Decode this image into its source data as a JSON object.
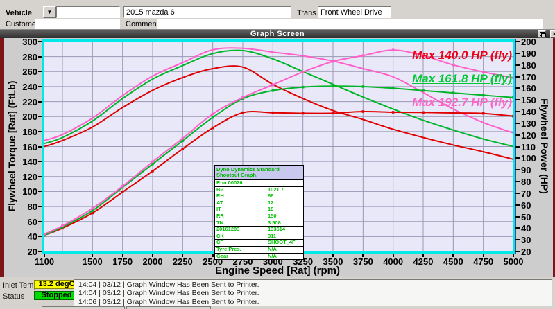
{
  "top_panel": {
    "vehicle_label": "Vehicle",
    "vehicle_select_value": "",
    "vehicle_name_value": "2015 mazda 6",
    "trans_label": "Trans.",
    "trans_value": "Front Wheel Drive",
    "customer_label": "Customer",
    "customer_value": "",
    "comment_label": "Comment",
    "comment_value": ""
  },
  "window": {
    "title": "Graph Screen"
  },
  "icons": {
    "dropdown_arrow": "▼",
    "close": "×"
  },
  "chart_data": {
    "type": "line",
    "xlabel": "Engine Speed [Rat] (rpm)",
    "ylabel_left": "Flywheel Torque [Rat] (FtLb)",
    "ylabel_right": "Flywheel Power (HP)",
    "xlim": [
      1100,
      5000
    ],
    "ylim_left": [
      20,
      300
    ],
    "ylim_right": [
      20,
      200
    ],
    "x_tick_labels": [
      1100,
      1500,
      1750,
      2000,
      2250,
      2500,
      2750,
      3000,
      3250,
      3500,
      3750,
      4000,
      4250,
      4500,
      4750,
      5000
    ],
    "left_ticks": [
      300,
      280,
      260,
      240,
      220,
      200,
      180,
      160,
      140,
      120,
      100,
      80,
      60,
      40,
      20
    ],
    "right_ticks": [
      200,
      190,
      180,
      170,
      160,
      150,
      140,
      130,
      120,
      110,
      100,
      90,
      80,
      70,
      60,
      50,
      40,
      30,
      20
    ],
    "grid": {
      "x_step_rpm": 250,
      "x_start_rpm": 1250,
      "y_step_left": 20
    },
    "x": [
      1100,
      1250,
      1500,
      1750,
      2000,
      2250,
      2500,
      2750,
      3000,
      3250,
      3500,
      3750,
      4000,
      4250,
      4500,
      4750,
      5000
    ],
    "series": [
      {
        "name": "torque-run1-red",
        "axis": "left",
        "color": "#e00000",
        "markers": false,
        "values": [
          160,
          168,
          186,
          212,
          235,
          252,
          264,
          266,
          243,
          224,
          208,
          196,
          183,
          172,
          162,
          153,
          143
        ]
      },
      {
        "name": "torque-run2-green",
        "axis": "left",
        "color": "#00b428",
        "markers": false,
        "values": [
          164,
          172,
          194,
          224,
          250,
          268,
          284,
          288,
          277,
          260,
          243,
          226,
          210,
          195,
          182,
          170,
          160
        ]
      },
      {
        "name": "torque-run3-pink",
        "axis": "left",
        "color": "#ff5fc8",
        "markers": false,
        "values": [
          168,
          176,
          198,
          228,
          254,
          272,
          289,
          291,
          286,
          281,
          274,
          264,
          253,
          232,
          210,
          192,
          178
        ]
      },
      {
        "name": "power-run1-red",
        "axis": "right",
        "color": "#e00000",
        "markers": true,
        "values": [
          34,
          40,
          53,
          71,
          89,
          108,
          126,
          139,
          139,
          138.5,
          138.6,
          140,
          139.4,
          139.2,
          138.8,
          138.4,
          136
        ]
      },
      {
        "name": "power-run2-green",
        "axis": "right",
        "color": "#00b428",
        "markers": true,
        "values": [
          34,
          41,
          55,
          75,
          95,
          115,
          135,
          151,
          158,
          161,
          161.8,
          161.4,
          160,
          158,
          156,
          154,
          152
        ]
      },
      {
        "name": "power-run3-pink",
        "axis": "right",
        "color": "#ff5fc8",
        "markers": true,
        "values": [
          35,
          42,
          57,
          76,
          97,
          117,
          138,
          152,
          163,
          174,
          183,
          188,
          192.7,
          188,
          180,
          174,
          169
        ]
      }
    ],
    "legend": [
      {
        "label": "Max 140.0 HP (fly)",
        "color": "#f00014"
      },
      {
        "label": "Max 161.8 HP (fly)",
        "color": "#00c832"
      },
      {
        "label": "Max 192.7 HP (fly)",
        "color": "#ff64c8"
      }
    ],
    "legend_position": "top-right",
    "plot_bg": "#e8e8f8",
    "grid_color": "#9898b4",
    "frame_color": "#00e8e8"
  },
  "info_table": {
    "header": "Dyno Dynamics Standard Shootout Graph.",
    "rows": [
      [
        "Run 00026",
        ""
      ],
      [
        "BP",
        "1021.7"
      ],
      [
        "RH",
        "66"
      ],
      [
        "AT",
        "12"
      ],
      [
        "IT",
        "10"
      ],
      [
        "RR",
        "150"
      ],
      [
        "TN",
        "3.508"
      ],
      [
        "20161203",
        "133614"
      ],
      [
        "CK",
        "311"
      ],
      [
        "CF",
        "SHOOT_4F"
      ],
      [
        "Tyre Pres.",
        "N/A"
      ],
      [
        "Gear",
        "N/A"
      ]
    ]
  },
  "status_bar": {
    "inlet_temp_label": "Inlet Temp",
    "inlet_temp_value": "13.2 degC",
    "status_label": "Status",
    "status_value": "Stopped",
    "log_lines": [
      "14:04 | 03/12 | Graph Window Has Been Sent to Printer.",
      "14:04 | 03/12 | Graph Window Has Been Sent to Printer.",
      "14:06 | 03/12 | Graph Window Has Been Sent to Printer."
    ]
  },
  "colors": {
    "chrome_bg": "#d6d3ce",
    "graph_area_bg": "#cdcdcd",
    "window_border": "#7b1518",
    "inlet_bg": "#ffff00",
    "status_bg": "#00dc00",
    "table_text": "#00c000"
  }
}
